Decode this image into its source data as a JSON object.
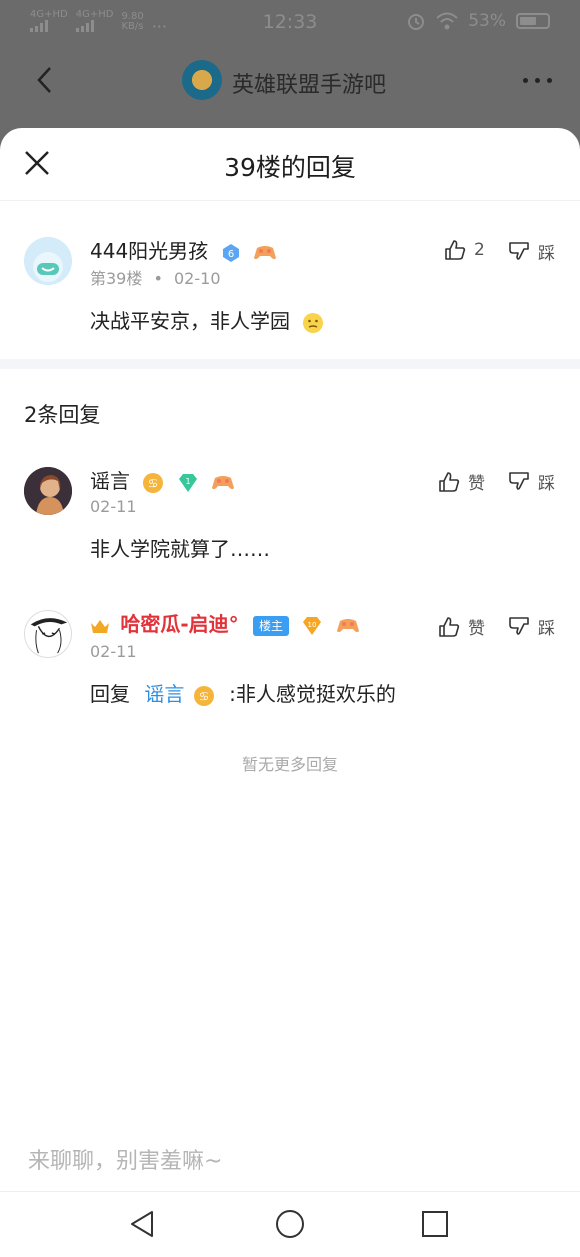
{
  "status_bar": {
    "signal1": "4G+HD",
    "signal2": "4G+HD",
    "speed": "9.80",
    "speed_unit": "KB/s",
    "dots": "···",
    "time": "12:33",
    "battery": "53%"
  },
  "app_bar": {
    "title": "英雄联盟手游吧"
  },
  "sheet": {
    "title": "39楼的回复"
  },
  "post": {
    "username": "444阳光男孩",
    "level": "6",
    "floor": "第39楼",
    "dot": "•",
    "date": "02-10",
    "content": "决战平安京，非人学园",
    "like_count": "2",
    "dislike_label": "踩"
  },
  "replies_header": {
    "count_label": "2条回复"
  },
  "replies": [
    {
      "username": "谣言",
      "level": "1",
      "date": "02-11",
      "content": "非人学院就算了……",
      "like_label": "赞",
      "dislike_label": "踩"
    },
    {
      "username": "哈密瓜-启迪°",
      "owner_tag": "楼主",
      "level": "10",
      "date": "02-11",
      "content_prefix": "回复",
      "mention": "谣言",
      "content_suffix": ":非人感觉挺欢乐的",
      "like_label": "赞",
      "dislike_label": "踩"
    }
  ],
  "footer": {
    "no_more": "暂无更多回复",
    "input_placeholder": "来聊聊，别害羞嘛~"
  },
  "colors": {
    "accent_blue": "#2c8fe3",
    "owner_red": "#e2333a",
    "dim_overlay": "#6b6b6b"
  }
}
